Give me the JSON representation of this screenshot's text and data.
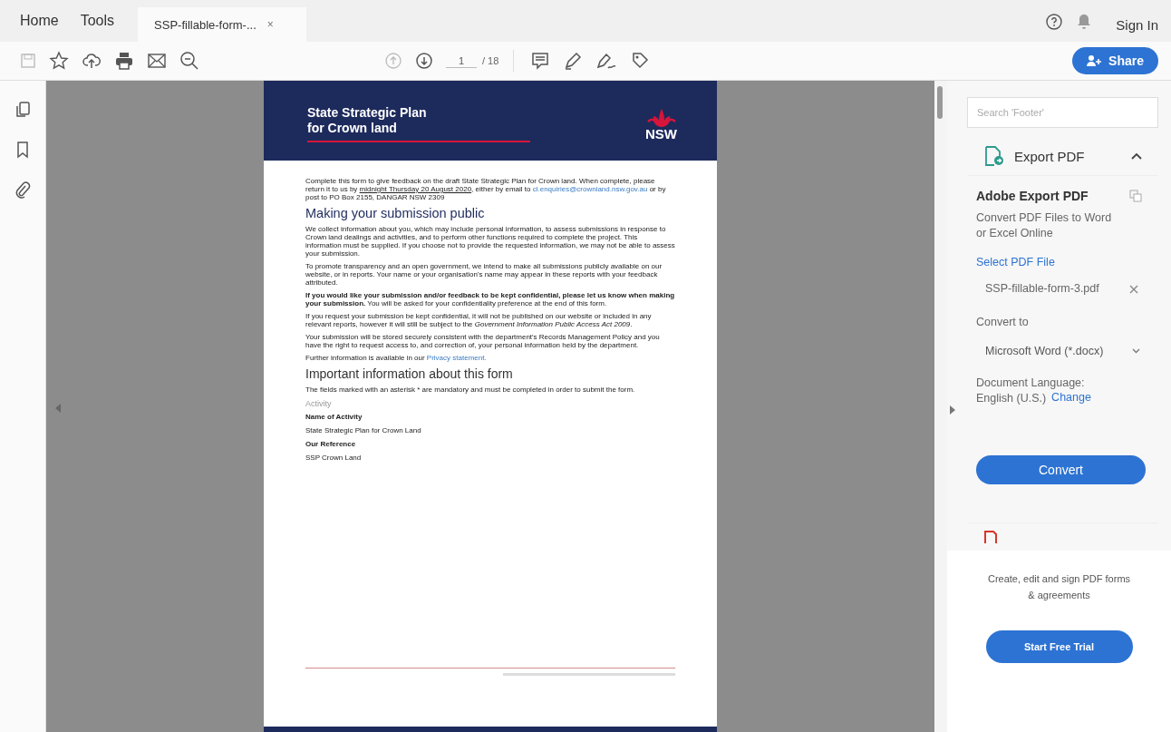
{
  "tabs": [
    {
      "label": "Home",
      "selected": false,
      "kind": "nav"
    },
    {
      "label": "Tools",
      "selected": false,
      "kind": "nav"
    },
    {
      "label": "SSP-fillable-form-...",
      "selected": true,
      "kind": "doc",
      "close": "×"
    }
  ],
  "header_actions": {
    "sign_in": "Sign In",
    "share": "Share"
  },
  "toolbar": {
    "page": "1",
    "page_total": "/ 18"
  },
  "document": {
    "banner_title": [
      "State Strategic Plan",
      "for Crown land"
    ],
    "logo_text": "NSW",
    "blocks": [
      {
        "kind": "para",
        "segments": [
          {
            "kind": "plain",
            "t": "Complete this form to give feedback on the draft State Strategic Plan for Crown land. When complete, please return it to us by "
          },
          {
            "kind": "underline",
            "t": "midnight Thursday 20 August 2020"
          },
          {
            "kind": "plain",
            "t": ", either by email to "
          },
          {
            "kind": "link",
            "t": "cl.enquiries@crownland.nsw.gov.au"
          },
          {
            "kind": "plain",
            "t": " or by post to PO Box 2155, DANGAR NSW 2309"
          }
        ]
      },
      {
        "kind": "heading",
        "text": "Making your submission public"
      },
      {
        "kind": "para",
        "segments": [
          {
            "kind": "plain",
            "t": "We collect information about you, which may include personal information, to assess submissions in response to Crown land dealings and activities, and to perform other functions required to complete the project. This information must be supplied. If you choose not to provide the requested information, we may not be able to assess your submission."
          }
        ]
      },
      {
        "kind": "para",
        "segments": [
          {
            "kind": "plain",
            "t": "To promote transparency and an open government, we intend to make all submissions publicly available on our website, or in reports. Your name or your organisation's name may appear in these reports with your feedback attributed."
          }
        ]
      },
      {
        "kind": "para",
        "segments": [
          {
            "kind": "bold",
            "t": "If you would like your submission and/or feedback to be kept confidential, please let us know when making your submission."
          },
          {
            "kind": "plain",
            "t": " You will be asked for your confidentiality preference at the end of this form."
          }
        ]
      },
      {
        "kind": "para",
        "segments": [
          {
            "kind": "plain",
            "t": "If you request your submission be kept confidential, it will not be published on our website or included in any relevant reports, however it will still be subject to the "
          },
          {
            "kind": "italic",
            "t": "Government Information Public Access Act 2009"
          },
          {
            "kind": "plain",
            "t": "."
          }
        ]
      },
      {
        "kind": "para",
        "segments": [
          {
            "kind": "plain",
            "t": "Your submission will be stored securely consistent with the department's Records Management Policy and you have the right to request access to, and correction of, your personal information held by the department."
          }
        ]
      },
      {
        "kind": "para",
        "segments": [
          {
            "kind": "plain",
            "t": "Further information is available in our "
          },
          {
            "kind": "link",
            "t": "Privacy statement."
          }
        ]
      },
      {
        "kind": "subheading",
        "text": "Important information about this form"
      },
      {
        "kind": "para",
        "segments": [
          {
            "kind": "plain",
            "t": "The fields marked with an asterisk * are mandatory and must be completed in order to submit the form."
          }
        ]
      },
      {
        "kind": "section",
        "text": "Activity"
      },
      {
        "kind": "label",
        "text": "Name of Activity"
      },
      {
        "kind": "value",
        "text": "State Strategic Plan for Crown Land"
      },
      {
        "kind": "label",
        "text": "Our Reference"
      },
      {
        "kind": "value",
        "text": "SSP Crown Land"
      }
    ]
  },
  "panel": {
    "search": {
      "placeholder": "Search 'Footer'"
    },
    "tool": "Export PDF",
    "expanded": true,
    "heading": "Adobe Export PDF",
    "description": "Convert PDF Files to Word or Excel Online",
    "select_link": "Select PDF File",
    "file": "SSP-fillable-form-3.pdf",
    "convert_to": "Convert to",
    "format": "Microsoft Word (*.docx)",
    "language_label": "Document Language:",
    "language": "English (U.S.)",
    "change": "Change",
    "convert": "Convert",
    "promo": "Create, edit and sign PDF forms & agreements",
    "trial": "Start Free Trial"
  }
}
